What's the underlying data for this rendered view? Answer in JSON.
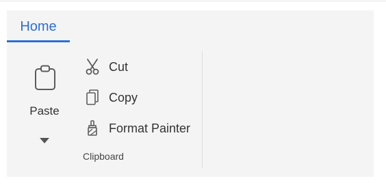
{
  "tabs": [
    {
      "label": "Home",
      "active": true
    }
  ],
  "accent_color": "#2b6fd6",
  "clipboard": {
    "group_label": "Clipboard",
    "paste": {
      "label": "Paste",
      "icon": "clipboard-icon"
    },
    "commands": [
      {
        "label": "Cut",
        "icon": "scissors-icon"
      },
      {
        "label": "Copy",
        "icon": "copy-icon"
      },
      {
        "label": "Format Painter",
        "icon": "paintbrush-icon"
      }
    ]
  }
}
